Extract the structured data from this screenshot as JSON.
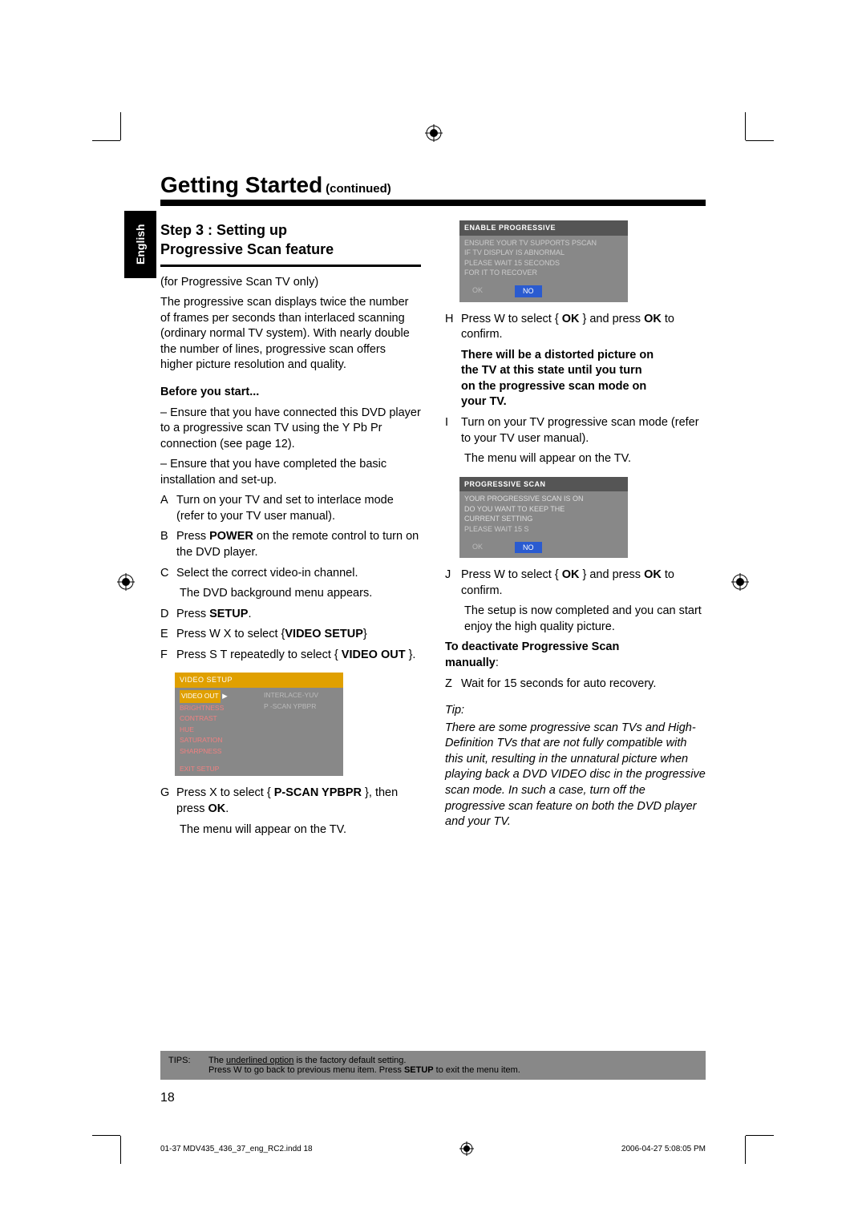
{
  "header": {
    "title": "Getting Started",
    "continued": "(continued)"
  },
  "lang_tab": "English",
  "left": {
    "step_title_l1": "Step 3 : Setting up",
    "step_title_l2": "Progressive Scan feature",
    "note": "(for Progressive Scan TV only)",
    "intro": "The progressive scan displays twice the number of frames per seconds than interlaced scanning (ordinary normal TV system). With nearly double the number of lines, progressive scan offers higher picture resolution and quality.",
    "before_label": "Before you start...",
    "before_1": "– Ensure that you have connected this DVD player to a progressive scan TV using the Y Pb Pr connection (see page 12).",
    "before_2": "– Ensure that you have completed the basic installation and set-up.",
    "A": "Turn on your TV and set to interlace mode (refer to your TV user manual).",
    "B_1": "Press ",
    "B_b": "POWER",
    "B_2": " on the remote control to turn on the DVD player.",
    "C": "Select the correct video-in channel.",
    "C_sub": "The DVD background menu appears.",
    "D_1": "Press ",
    "D_b": "SETUP",
    "D_2": ".",
    "E_1": "Press  W  X to select {",
    "E_b": "VIDEO SETUP",
    "E_2": "}",
    "F_1": "Press  S  T repeatedly to select { ",
    "F_b": "VIDEO OUT",
    "F_2": " }.",
    "G_1": "Press  X to select { ",
    "G_b": "P-SCAN YPBPR",
    "G_2": " }, then press ",
    "G_b2": "OK",
    "G_3": ".",
    "G_sub": "The menu will appear on the TV."
  },
  "right": {
    "H_1": "Press  W to select { ",
    "H_b": "OK",
    "H_2": " } and press ",
    "H_b2": "OK",
    "H_3": " to confirm.",
    "warn_l1": "There will be a distorted picture on",
    "warn_l2": "the TV at this state until you turn",
    "warn_l3": "on the progressive scan mode on",
    "warn_l4": "your TV.",
    "I": "Turn on your TV progressive scan mode (refer to your TV user manual).",
    "I_sub": "The menu will appear on the TV.",
    "J_1": "Press  W to select { ",
    "J_b": "OK",
    "J_2": " } and press ",
    "J_b2": "OK",
    "J_3": " to confirm.",
    "J_sub": "The setup is now completed and you can start enjoy the high quality picture.",
    "deact_l1": "To deactivate Progressive Scan",
    "deact_l2": "manually",
    "deact_colon": ":",
    "Z": "Wait for 15 seconds for auto recovery.",
    "tip_label": "Tip:",
    "tip_body": "There are some progressive scan TVs and High-Definition TVs that are not fully compatible with this unit, resulting in the unnatural picture when playing back a DVD VIDEO disc in the progressive scan mode. In such a case, turn off the progressive scan feature on both the DVD player and your TV."
  },
  "osd_video": {
    "header": "VIDEO  SETUP",
    "items": [
      "VIDEO OUT",
      "BRIGHTNESS",
      "CONTRAST",
      "HUE",
      "SATURATION",
      "SHARPNESS"
    ],
    "right_items": [
      "INTERLACE-YUV",
      "P -SCAN YPBPR"
    ],
    "exit": "EXIT SETUP"
  },
  "osd_enable": {
    "header": "ENABLE PROGRESSIVE",
    "l1": "ENSURE YOUR TV SUPPORTS PSCAN",
    "l2": "IF TV DISPLAY IS ABNORMAL",
    "l3": "PLEASE WAIT 15 SECONDS",
    "l4": "FOR IT TO RECOVER",
    "ok": "OK",
    "no": "NO"
  },
  "osd_confirm": {
    "header": "PROGRESSIVE SCAN",
    "l1": "YOUR PROGRESSIVE SCAN IS ON",
    "l2": "DO YOU WANT TO KEEP THE",
    "l3": "CURRENT SETTING",
    "l4": "PLEASE WAIT 15 S",
    "ok": "OK",
    "no": "NO"
  },
  "tips_bar": {
    "label": "TIPS:",
    "l1_a": "The ",
    "l1_u": "underlined option",
    "l1_b": " is the factory default setting.",
    "l2_a": "Press  W to go back to previous menu item. Press ",
    "l2_b": "SETUP",
    "l2_c": " to exit the menu item."
  },
  "page_num": "18",
  "footer": {
    "file": "01-37 MDV435_436_37_eng_RC2.indd   18",
    "date": "2006-04-27   5:08:05 PM"
  }
}
